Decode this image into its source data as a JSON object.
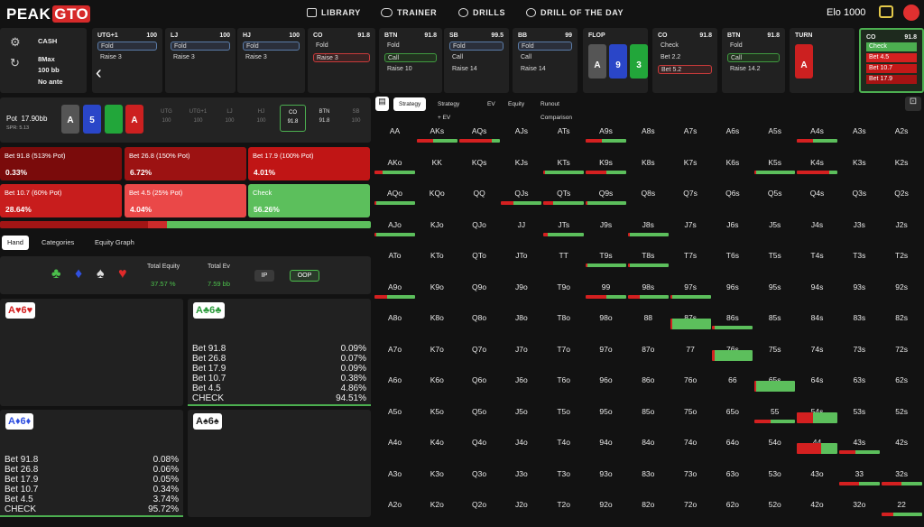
{
  "header": {
    "logo_a": "PEAK",
    "logo_b": "GTO",
    "nav": [
      "LIBRARY",
      "TRAINER",
      "DRILLS",
      "DRILL OF THE DAY"
    ],
    "elo": "Elo 1000"
  },
  "settings": {
    "type": "CASH",
    "players": "8Max",
    "stack": "100 bb",
    "ante": "No ante"
  },
  "actions": [
    {
      "pos": "UTG+1",
      "stack": "100",
      "a1": "Fold",
      "a2": "Raise 3",
      "sel": 1
    },
    {
      "pos": "LJ",
      "stack": "100",
      "a1": "Fold",
      "a2": "Raise 3",
      "sel": 1
    },
    {
      "pos": "HJ",
      "stack": "100",
      "a1": "Fold",
      "a2": "Raise 3",
      "sel": 1
    },
    {
      "pos": "CO",
      "stack": "91.8",
      "a1": "Fold",
      "a2": "Raise 3",
      "sel": 2
    },
    {
      "pos": "BTN",
      "stack": "91.8",
      "a1": "Fold",
      "a2": "Call",
      "a3": "Raise 10",
      "sel": 2
    },
    {
      "pos": "SB",
      "stack": "99.5",
      "a1": "Fold",
      "a2": "Call",
      "a3": "Raise 14",
      "sel": 1
    },
    {
      "pos": "BB",
      "stack": "99",
      "a1": "Fold",
      "a2": "Call",
      "a3": "Raise 14",
      "sel": 1
    },
    {
      "pos": "FLOP",
      "board": [
        "A",
        "9",
        "3"
      ]
    },
    {
      "pos": "CO",
      "stack": "91.8",
      "a1": "Check",
      "a2": "Bet 2.2",
      "a3": "Bet 5.2",
      "sel": 3
    },
    {
      "pos": "BTN",
      "stack": "91.8",
      "a1": "Fold",
      "a2": "Call",
      "a3": "Raise 14.2",
      "sel": 2
    },
    {
      "pos": "TURN",
      "board": [
        "A"
      ]
    },
    {
      "pos": "CO",
      "stack": "91.8",
      "opts": [
        "Check",
        "Bet 4.5",
        "Bet 10.7",
        "Bet 17.9"
      ]
    }
  ],
  "pot": {
    "label": "Pot",
    "value": "17.90bb",
    "spr": "SPR: 5.13",
    "board": [
      "A",
      "5",
      "",
      "A"
    ]
  },
  "seats": [
    {
      "n": "UTG",
      "s": "100"
    },
    {
      "n": "UTG+1",
      "s": "100"
    },
    {
      "n": "LJ",
      "s": "100"
    },
    {
      "n": "HJ",
      "s": "100"
    },
    {
      "n": "CO",
      "s": "91.8"
    },
    {
      "n": "BTN",
      "s": "91.8"
    },
    {
      "n": "SB",
      "s": "100"
    }
  ],
  "strategy": [
    {
      "label": "Bet 91.8 (513% Pot)",
      "value": "0.33%",
      "color": "#7a0b0b"
    },
    {
      "label": "Bet 26.8 (150% Pot)",
      "value": "6.72%",
      "color": "#9c1212"
    },
    {
      "label": "Bet 17.9 (100% Pot)",
      "value": "4.01%",
      "color": "#c01515"
    },
    {
      "label": "Bet 10.7 (60% Pot)",
      "value": "28.64%",
      "color": "#c81d1d"
    },
    {
      "label": "Bet 4.5 (25% Pot)",
      "value": "4.04%",
      "color": "#ea4848"
    },
    {
      "label": "Check",
      "value": "56.26%",
      "color": "#5cbf5c"
    }
  ],
  "tabs": {
    "hand": "Hand",
    "categories": "Categories",
    "equity_graph": "Equity Graph"
  },
  "summary": {
    "te_label": "Total Equity",
    "te": "37.57 %",
    "tev_label": "Total Ev",
    "tev": "7.59 bb",
    "ip": "IP",
    "oop": "OOP"
  },
  "hands": [
    {
      "label": "A♥6♥",
      "rows": []
    },
    {
      "label": "A♣6♣",
      "rows": [
        [
          "Bet 91.8",
          "0.09%"
        ],
        [
          "Bet 26.8",
          "0.07%"
        ],
        [
          "Bet 17.9",
          "0.09%"
        ],
        [
          "Bet 10.7",
          "0.38%"
        ],
        [
          "Bet 4.5",
          "4.86%"
        ],
        [
          "CHECK",
          "94.51%"
        ]
      ]
    },
    {
      "label": "A♦6♦",
      "rows": [
        [
          "Bet 91.8",
          "0.08%"
        ],
        [
          "Bet 26.8",
          "0.06%"
        ],
        [
          "Bet 17.9",
          "0.05%"
        ],
        [
          "Bet 10.7",
          "0.34%"
        ],
        [
          "Bet 4.5",
          "3.74%"
        ],
        [
          "CHECK",
          "95.72%"
        ]
      ]
    },
    {
      "label": "A♠6♠",
      "rows": []
    }
  ],
  "right_tabs": [
    "Strategy",
    "Strategy + EV",
    "EV",
    "Equity",
    "Runout Comparison"
  ],
  "colors": {
    "check": "#5cbf5c",
    "bet": "#d42020",
    "panel": "#212121"
  }
}
